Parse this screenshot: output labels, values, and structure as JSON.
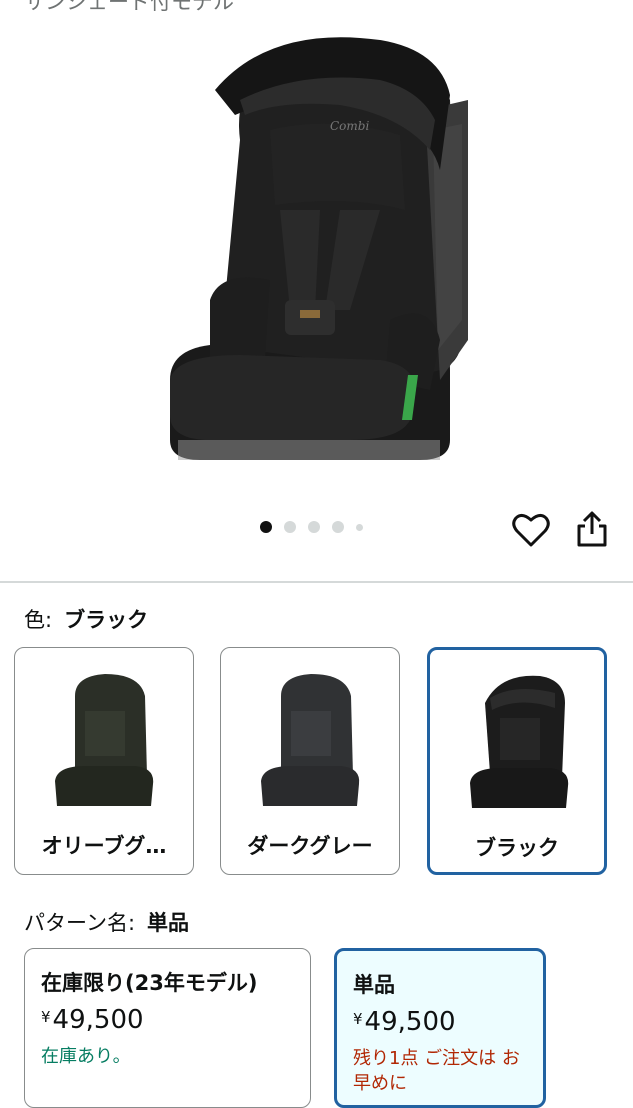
{
  "hero": {
    "caption": "サンシェード付モデル",
    "brand_mark": "Combi",
    "carousel": {
      "count": 5,
      "active_index": 0
    }
  },
  "color": {
    "label": "色:",
    "selected": "ブラック",
    "options": [
      {
        "name": "オリーブグ…",
        "tone": "#2b2f27"
      },
      {
        "name": "ダークグレー",
        "tone": "#303234"
      },
      {
        "name": "ブラック",
        "tone": "#1c1c1c"
      }
    ]
  },
  "pattern": {
    "label": "パターン名:",
    "selected": "単品",
    "options": [
      {
        "title": "在庫限り(23年モデル)",
        "currency": "¥",
        "price": "49,500",
        "status": "在庫あり。",
        "status_color": "#067d62"
      },
      {
        "title": "単品",
        "currency": "¥",
        "price": "49,500",
        "status": "残り1点 ご注文は お早めに",
        "status_color": "#b12704"
      }
    ]
  },
  "icons": {
    "heart": "heart-icon",
    "share": "share-icon"
  },
  "colors": {
    "accent": "#2162a1",
    "selected_bg": "#edfdff"
  }
}
